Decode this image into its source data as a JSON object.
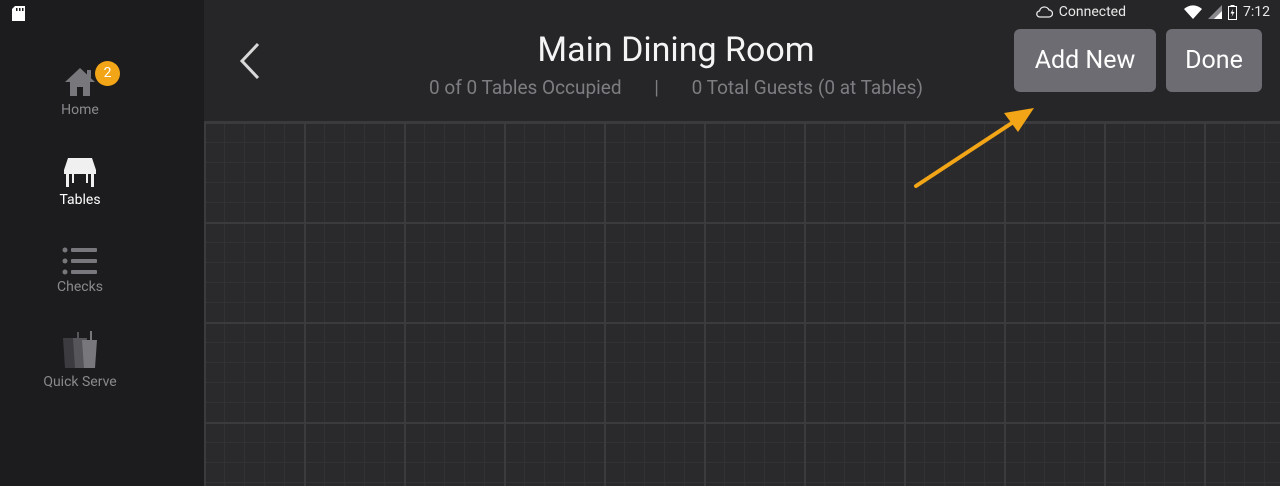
{
  "status_bar": {
    "connection_label": "Connected",
    "time": "7:12"
  },
  "sidebar": {
    "items": [
      {
        "label": "Home",
        "icon": "home-icon",
        "badge": "2"
      },
      {
        "label": "Tables",
        "icon": "table-icon",
        "active": true
      },
      {
        "label": "Checks",
        "icon": "list-icon"
      },
      {
        "label": "Quick Serve",
        "icon": "cups-icon"
      }
    ]
  },
  "header": {
    "title": "Main Dining Room",
    "tables_occupied": "0 of 0 Tables Occupied",
    "separator": "|",
    "guests": "0 Total Guests (0 at Tables)",
    "add_new_label": "Add New",
    "done_label": "Done"
  },
  "colors": {
    "accent": "#f2a516",
    "button_bg": "#6c6c72",
    "background": "#2a2a2c",
    "sidebar_bg": "#1c1c1e"
  }
}
